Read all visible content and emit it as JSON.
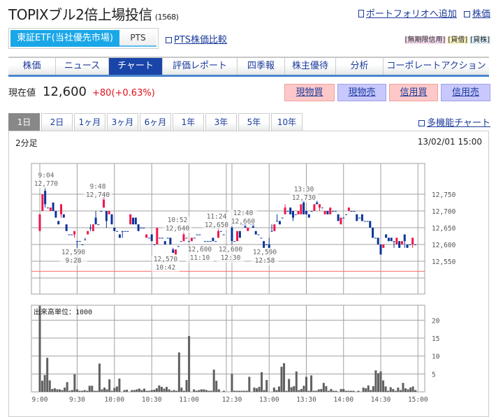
{
  "header": {
    "title": "TOPIXブル2倍上場投信",
    "code": "(1568)",
    "add_portfolio": "ポートフォリオへ追加",
    "stock_price_link": "株価"
  },
  "market": {
    "primary": "東証ETF(当社優先市場)",
    "pts": "PTS",
    "pts_compare": "PTS株価比較",
    "tags": [
      {
        "label": "[無期限信用]",
        "color": "#f6dcf0"
      },
      {
        "label": "[貸借]",
        "color": "#f6f0c0"
      },
      {
        "label": "[貸株]",
        "color": "#dcecf6"
      }
    ]
  },
  "nav": {
    "tabs": [
      "株価",
      "ニュース",
      "チャート",
      "評価レポート",
      "四季報",
      "株主優待",
      "分析",
      "コーポレートアクション"
    ],
    "active": 2
  },
  "quote": {
    "label": "現在値",
    "price": "12,600",
    "change": "+80",
    "change_pct": "(+0.63%)"
  },
  "trade_buttons": [
    "現物買",
    "現物売",
    "信用買",
    "信用売"
  ],
  "period_tabs": {
    "items": [
      "1日",
      "2日",
      "1ヶ月",
      "3ヶ月",
      "6ヶ月",
      "1年",
      "3年",
      "5年",
      "10年"
    ],
    "active": 0
  },
  "multi_chart_link": "多機能チャート",
  "chart_panel": {
    "interval": "2分足",
    "timestamp": "13/02/01 15:00"
  },
  "colors": {
    "up": "#f0164a",
    "down": "#0a3399",
    "prev_close_line": "#ff6a6a",
    "grid": "#a0a0a0",
    "volume": "#606060"
  },
  "chart_data": [
    {
      "type": "candlestick",
      "title": "2分足",
      "yticks": [
        "12,750",
        "12,700",
        "12,650",
        "12,600",
        "12,550"
      ],
      "ytick_values": [
        12750,
        12700,
        12650,
        12600,
        12550
      ],
      "prev_close": 12520,
      "ylim": [
        12455,
        12845
      ],
      "annotations": [
        {
          "time": "9:04",
          "price": "12,770"
        },
        {
          "time": "9:48",
          "price": "12,740"
        },
        {
          "price": "12,590",
          "time": "9:28"
        },
        {
          "time": "10:52",
          "price": "12,640"
        },
        {
          "price": "12,570",
          "time": "10:42"
        },
        {
          "time": "11:24",
          "price": "12,650"
        },
        {
          "price": "12,600",
          "time": "11:10"
        },
        {
          "time": "12:40",
          "price": "12,660"
        },
        {
          "price": "12,600",
          "time": "12:30"
        },
        {
          "price": "12,590",
          "time": "12:58"
        },
        {
          "time": "13:30",
          "price": "12,730"
        }
      ],
      "morning_ohlc": [
        [
          12640,
          12690,
          12640,
          12690
        ],
        [
          12700,
          12750,
          12700,
          12750
        ],
        [
          12760,
          12770,
          12710,
          12720
        ],
        [
          12710,
          12710,
          12710,
          12710
        ],
        [
          12700,
          12710,
          12700,
          12710
        ],
        [
          12725,
          12725,
          12700,
          12700
        ],
        [
          12700,
          12700,
          12680,
          12680
        ],
        [
          12670,
          12670,
          12660,
          12660
        ],
        [
          12690,
          12720,
          12680,
          12720
        ],
        [
          12690,
          12690,
          12680,
          12680
        ],
        [
          12660,
          12660,
          12640,
          12640
        ],
        [
          12630,
          12630,
          12630,
          12630
        ],
        [
          12630,
          12630,
          12630,
          12630
        ],
        [
          12630,
          12640,
          12620,
          12640
        ],
        [
          12610,
          12610,
          12590,
          12610
        ],
        [
          12610,
          12610,
          12610,
          12610
        ],
        [
          12600,
          12600,
          12600,
          12600
        ],
        [
          12615,
          12620,
          12615,
          12615
        ],
        [
          12630,
          12640,
          12630,
          12640
        ],
        [
          12650,
          12660,
          12640,
          12650
        ],
        [
          12640,
          12660,
          12640,
          12660
        ],
        [
          12680,
          12700,
          12660,
          12660
        ],
        [
          12660,
          12660,
          12660,
          12660
        ],
        [
          12700,
          12700,
          12700,
          12700
        ],
        [
          12710,
          12740,
          12710,
          12740
        ],
        [
          12700,
          12700,
          12650,
          12670
        ],
        [
          12690,
          12700,
          12690,
          12700
        ],
        [
          12690,
          12690,
          12660,
          12660
        ],
        [
          12650,
          12650,
          12640,
          12640
        ],
        [
          12640,
          12640,
          12640,
          12640
        ],
        [
          12630,
          12630,
          12620,
          12620
        ],
        [
          12640,
          12640,
          12620,
          12640
        ],
        [
          12640,
          12640,
          12640,
          12640
        ],
        [
          12640,
          12640,
          12640,
          12640
        ],
        [
          12660,
          12690,
          12660,
          12690
        ],
        [
          12680,
          12680,
          12660,
          12660
        ],
        [
          12680,
          12680,
          12660,
          12660
        ],
        [
          12660,
          12660,
          12640,
          12640
        ],
        [
          12650,
          12650,
          12650,
          12650
        ],
        [
          12650,
          12650,
          12650,
          12650
        ],
        [
          12620,
          12630,
          12620,
          12630
        ],
        [
          12620,
          12620,
          12620,
          12620
        ],
        [
          12630,
          12630,
          12610,
          12610
        ],
        [
          12600,
          12600,
          12600,
          12600
        ],
        [
          12600,
          12650,
          12600,
          12650
        ],
        [
          12620,
          12620,
          12620,
          12620
        ],
        [
          12620,
          12620,
          12620,
          12620
        ],
        [
          12610,
          12610,
          12600,
          12600
        ],
        [
          12620,
          12620,
          12620,
          12620
        ],
        [
          12620,
          12620,
          12600,
          12600
        ],
        [
          12585,
          12590,
          12575,
          12575
        ],
        [
          12570,
          12585,
          12570,
          12585
        ],
        [
          12595,
          12595,
          12595,
          12595
        ],
        [
          12610,
          12610,
          12610,
          12610
        ],
        [
          12610,
          12640,
          12610,
          12630
        ],
        [
          12620,
          12620,
          12620,
          12620
        ],
        [
          12610,
          12610,
          12610,
          12610
        ],
        [
          12610,
          12620,
          12610,
          12620
        ],
        [
          12620,
          12620,
          12620,
          12620
        ],
        [
          12630,
          12630,
          12630,
          12630
        ],
        [
          12630,
          12630,
          12630,
          12630
        ],
        [
          12595,
          12595,
          12595,
          12595
        ],
        [
          12610,
          12610,
          12610,
          12610
        ],
        [
          12610,
          12610,
          12610,
          12610
        ],
        [
          12610,
          12610,
          12610,
          12610
        ],
        [
          12620,
          12620,
          12610,
          12610
        ],
        [
          12610,
          12610,
          12610,
          12610
        ],
        [
          12620,
          12650,
          12620,
          12640
        ],
        [
          12640,
          12640,
          12640,
          12640
        ],
        [
          12630,
          12630,
          12630,
          12630
        ]
      ],
      "afternoon_ohlc": [
        [
          12650,
          12660,
          12600,
          12610
        ],
        [
          12610,
          12610,
          12610,
          12610
        ],
        [
          12610,
          12640,
          12610,
          12640
        ],
        [
          12640,
          12640,
          12620,
          12620
        ],
        [
          12660,
          12660,
          12660,
          12660
        ],
        [
          12660,
          12660,
          12650,
          12650
        ],
        [
          12640,
          12650,
          12640,
          12650
        ],
        [
          12660,
          12660,
          12660,
          12660
        ],
        [
          12660,
          12660,
          12650,
          12650
        ],
        [
          12640,
          12640,
          12630,
          12630
        ],
        [
          12630,
          12630,
          12630,
          12630
        ],
        [
          12620,
          12620,
          12620,
          12620
        ],
        [
          12610,
          12610,
          12590,
          12590
        ],
        [
          12600,
          12600,
          12600,
          12600
        ],
        [
          12600,
          12620,
          12590,
          12590
        ],
        [
          12640,
          12660,
          12640,
          12640
        ],
        [
          12640,
          12660,
          12640,
          12660
        ],
        [
          12670,
          12690,
          12670,
          12670
        ],
        [
          12670,
          12670,
          12660,
          12660
        ],
        [
          12680,
          12680,
          12680,
          12680
        ],
        [
          12690,
          12720,
          12690,
          12710
        ],
        [
          12700,
          12700,
          12700,
          12700
        ],
        [
          12710,
          12710,
          12690,
          12690
        ],
        [
          12700,
          12700,
          12670,
          12680
        ],
        [
          12690,
          12690,
          12690,
          12690
        ],
        [
          12690,
          12700,
          12690,
          12700
        ],
        [
          12690,
          12720,
          12690,
          12720
        ],
        [
          12730,
          12730,
          12690,
          12690
        ],
        [
          12700,
          12700,
          12690,
          12690
        ],
        [
          12690,
          12690,
          12680,
          12680
        ],
        [
          12700,
          12700,
          12700,
          12700
        ],
        [
          12700,
          12720,
          12700,
          12720
        ],
        [
          12730,
          12730,
          12720,
          12720
        ],
        [
          12710,
          12720,
          12700,
          12720
        ],
        [
          12710,
          12710,
          12710,
          12710
        ],
        [
          12690,
          12700,
          12690,
          12700
        ],
        [
          12700,
          12700,
          12690,
          12690
        ],
        [
          12690,
          12710,
          12690,
          12710
        ],
        [
          12700,
          12700,
          12700,
          12700
        ],
        [
          12700,
          12700,
          12700,
          12700
        ],
        [
          12690,
          12690,
          12670,
          12670
        ],
        [
          12660,
          12680,
          12660,
          12680
        ],
        [
          12680,
          12680,
          12680,
          12680
        ],
        [
          12690,
          12690,
          12690,
          12690
        ],
        [
          12700,
          12710,
          12700,
          12710
        ],
        [
          12700,
          12700,
          12700,
          12700
        ],
        [
          12700,
          12700,
          12700,
          12700
        ],
        [
          12690,
          12690,
          12670,
          12670
        ],
        [
          12680,
          12680,
          12680,
          12680
        ],
        [
          12690,
          12690,
          12670,
          12670
        ],
        [
          12670,
          12670,
          12670,
          12670
        ],
        [
          12670,
          12670,
          12670,
          12670
        ],
        [
          12670,
          12670,
          12650,
          12650
        ],
        [
          12650,
          12650,
          12620,
          12620
        ],
        [
          12620,
          12620,
          12620,
          12620
        ],
        [
          12620,
          12620,
          12600,
          12600
        ],
        [
          12600,
          12600,
          12570,
          12570
        ],
        [
          12590,
          12600,
          12590,
          12600
        ],
        [
          12630,
          12630,
          12620,
          12620
        ],
        [
          12620,
          12620,
          12610,
          12610
        ],
        [
          12620,
          12620,
          12610,
          12610
        ],
        [
          12610,
          12610,
          12590,
          12610
        ],
        [
          12600,
          12620,
          12600,
          12620
        ],
        [
          12610,
          12610,
          12590,
          12590
        ],
        [
          12600,
          12610,
          12600,
          12610
        ],
        [
          12630,
          12630,
          12590,
          12610
        ],
        [
          12600,
          12600,
          12590,
          12590
        ],
        [
          12600,
          12600,
          12600,
          12600
        ],
        [
          12600,
          12620,
          12590,
          12620
        ],
        [
          12600,
          12600,
          12600,
          12600
        ]
      ]
    },
    {
      "type": "bar",
      "title": "出来高単位：1000",
      "ylim": [
        0,
        24
      ],
      "yticks": [
        "20",
        "15",
        "10",
        "5"
      ],
      "ytick_values": [
        20,
        15,
        10,
        5
      ],
      "xticks": [
        "9:00",
        "9:30",
        "10:00",
        "10:30",
        "11:00",
        "12:30",
        "13:00",
        "13:30",
        "14:00",
        "14:30",
        "15:00"
      ],
      "morning_volume": [
        24,
        3.1,
        4.7,
        9.5,
        3.2,
        0.8,
        1,
        0.7,
        0.7,
        0.5,
        1.2,
        2.7,
        0.3,
        0.5,
        4.9,
        0.7,
        0.3,
        0.3,
        0.5,
        0.3,
        1.7,
        1.7,
        0.3,
        0.3,
        7.9,
        0.7,
        1.2,
        0.7,
        3.5,
        0.3,
        1.1,
        1.5,
        3.7,
        0,
        0.5,
        0.6,
        0,
        0.5,
        0.5,
        0.7,
        0.9,
        0.5,
        0.9,
        0.3,
        0.3,
        0.5,
        0.6,
        1,
        1.8,
        1.4,
        0.9,
        1.4,
        0.7,
        0.3,
        0.5,
        0.3,
        11,
        1.2,
        0.3,
        3.3,
        15.6,
        0,
        0.7,
        0.3,
        0.5,
        0.7,
        0.7,
        0.5,
        0.3,
        0.3,
        6.2,
        3.1,
        0.7,
        0,
        0.3
      ],
      "afternoon_volume": [
        5,
        0.3,
        0.3,
        0.3,
        0.3,
        0.3,
        0.3,
        4.2,
        0,
        1.2,
        1,
        1.4,
        5.5,
        0.5,
        3.3,
        0,
        0,
        1.2,
        0.5,
        1.5,
        7,
        8,
        0.3,
        3.6,
        1.3,
        1.6,
        5.7,
        0.5,
        0.8,
        1.7,
        4.2,
        0.3,
        4.6,
        0.3,
        0.3,
        0.7,
        0.8,
        2.5,
        1.6,
        0.3,
        0.8,
        0.3,
        0.3,
        0,
        0.8,
        0.8,
        0.3,
        0.3,
        0.3,
        0.3,
        0,
        0.3,
        0,
        1.2,
        1,
        1.8,
        0.5,
        1.6,
        6,
        5.2,
        5.7,
        3.2,
        1.5,
        0.3,
        1.3,
        0.8,
        0.3,
        1.2,
        0.5,
        2.5,
        1,
        0.7,
        1.2,
        1.5,
        0.5
      ]
    }
  ]
}
